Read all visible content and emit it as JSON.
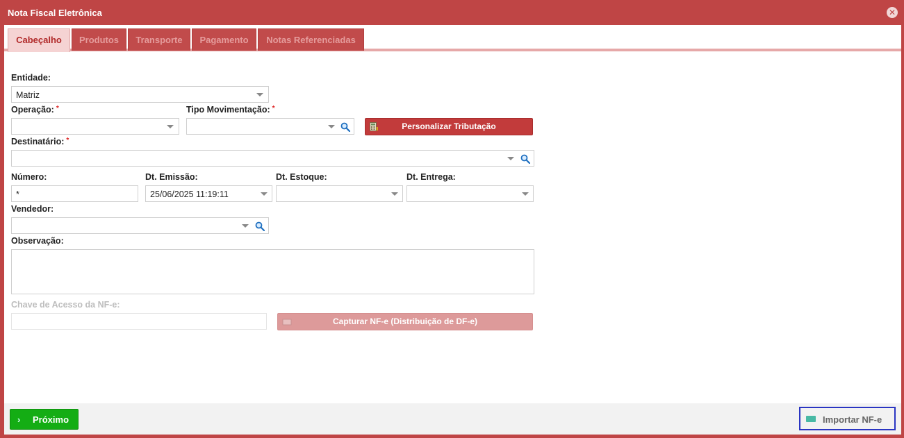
{
  "window": {
    "title": "Nota Fiscal Eletrônica",
    "close_icon": "close-circle-icon"
  },
  "tabs": [
    {
      "label": "Cabeçalho",
      "active": true
    },
    {
      "label": "Produtos",
      "active": false
    },
    {
      "label": "Transporte",
      "active": false
    },
    {
      "label": "Pagamento",
      "active": false
    },
    {
      "label": "Notas Referenciadas",
      "active": false
    }
  ],
  "form": {
    "entidade": {
      "label": "Entidade:",
      "value": "Matriz"
    },
    "operacao": {
      "label": "Operação:",
      "required": "*",
      "value": ""
    },
    "tipo_movimentacao": {
      "label": "Tipo Movimentação:",
      "required": "*",
      "value": ""
    },
    "personalizar_button": "Personalizar Tributação",
    "destinatario": {
      "label": "Destinatário:",
      "required": "*",
      "value": ""
    },
    "numero": {
      "label": "Número:",
      "value": "*"
    },
    "dt_emissao": {
      "label": "Dt. Emissão:",
      "value": "25/06/2025 11:19:11"
    },
    "dt_estoque": {
      "label": "Dt. Estoque:",
      "value": ""
    },
    "dt_entrega": {
      "label": "Dt. Entrega:",
      "value": ""
    },
    "vendedor": {
      "label": "Vendedor:",
      "value": ""
    },
    "observacao": {
      "label": "Observação:",
      "value": ""
    },
    "chave_acesso": {
      "label": "Chave de Acesso da NF-e:",
      "value": ""
    },
    "capturar_button": "Capturar NF-e (Distribuição de DF-e)"
  },
  "footer": {
    "next_label": "Próximo",
    "import_label": "Importar NF-e"
  },
  "colors": {
    "primary": "#bf4545",
    "tab_active_bg": "#f5d3d3",
    "next_green": "#14ad14",
    "import_border": "#2a35c2"
  }
}
